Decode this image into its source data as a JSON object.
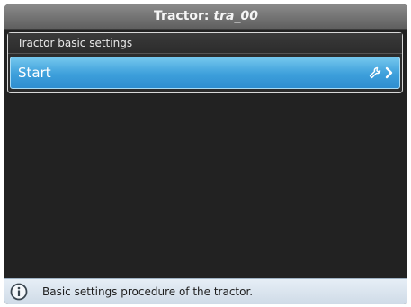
{
  "title": {
    "prefix": "Tractor: ",
    "name": "tra_00"
  },
  "panel": {
    "header": "Tractor basic settings"
  },
  "start_row": {
    "label": "Start",
    "icons": [
      "wrench-icon",
      "chevron-right-icon"
    ]
  },
  "status": {
    "icon": "info-icon",
    "text": "Basic settings procedure of the tractor."
  }
}
